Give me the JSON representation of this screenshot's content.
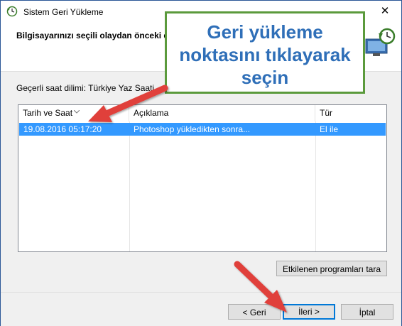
{
  "window": {
    "title": "Sistem Geri Yükleme",
    "close_glyph": "✕"
  },
  "header": {
    "text": "Bilgisayarınızı seçili olaydan önceki du"
  },
  "timezone_label": "Geçerli saat dilimi: Türkiye Yaz Saati",
  "table": {
    "columns": [
      "Tarih ve Saat",
      "Açıklama",
      "Tür"
    ],
    "rows": [
      {
        "date": "19.08.2016 05:17:20",
        "description": "Photoshop yükledikten sonra...",
        "type": "El ile",
        "selected": true
      }
    ]
  },
  "buttons": {
    "scan": "Etkilenen programları tara",
    "back": "< Geri",
    "next": "İleri >",
    "cancel": "İptal"
  },
  "callout": {
    "line1": "Geri yükleme",
    "line2": "noktasını tıklayarak",
    "line3": "seçin"
  },
  "colors": {
    "selection": "#3399ff",
    "callout_border": "#5b9a3c",
    "callout_text": "#2f6fb8",
    "arrow": "#e0403a"
  },
  "icons": [
    "system-restore-icon",
    "close-icon",
    "restore-monitor-icon",
    "sort-arrow-icon"
  ]
}
